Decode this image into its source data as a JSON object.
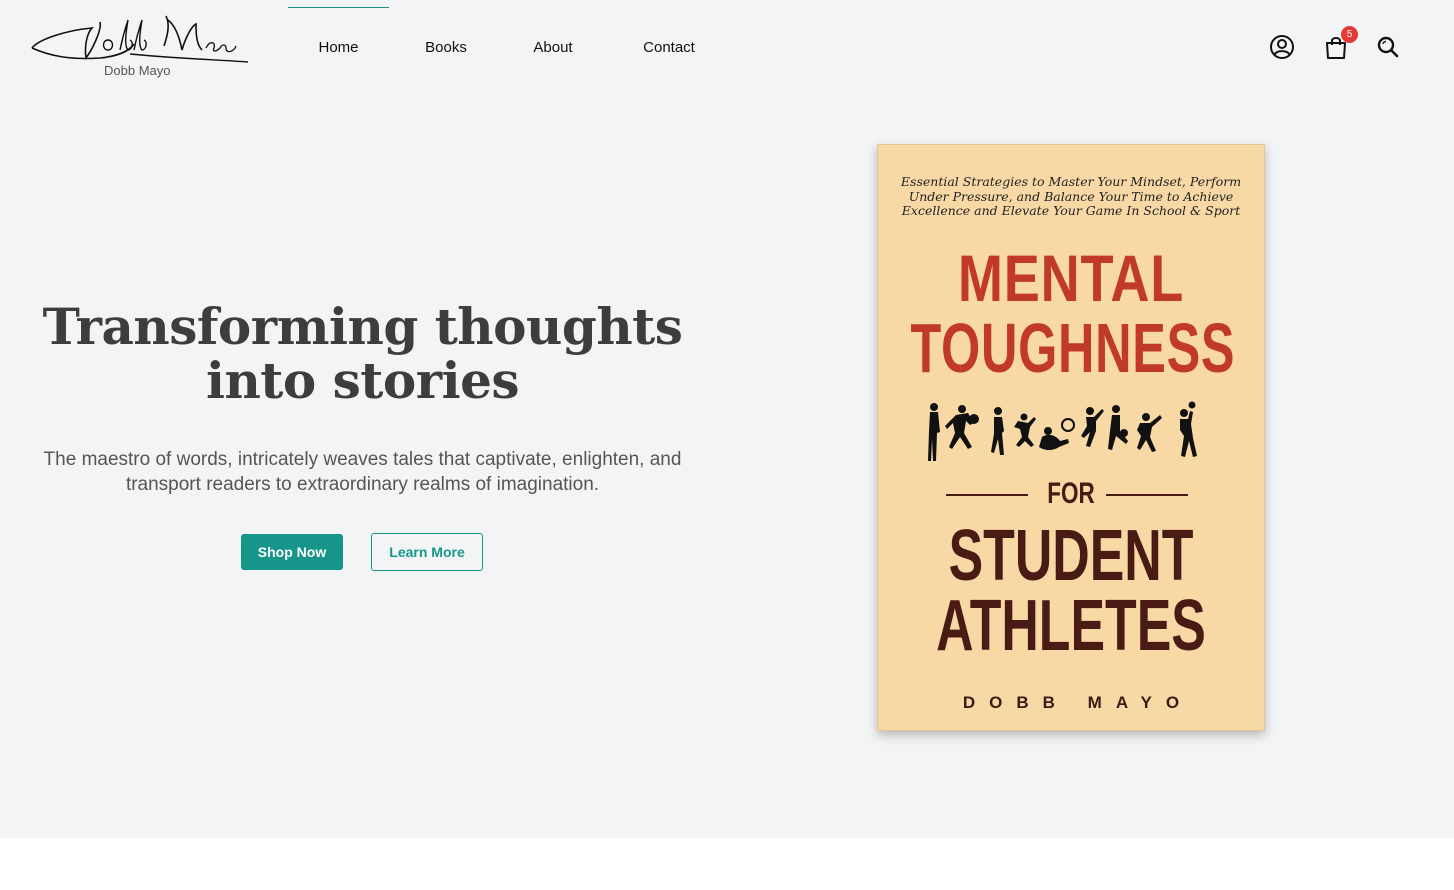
{
  "brand": {
    "signature": "Dobb Mayo",
    "caption": "Dobb Mayo"
  },
  "nav": {
    "items": [
      {
        "label": "Home",
        "active": true
      },
      {
        "label": "Books",
        "active": false
      },
      {
        "label": "About",
        "active": false
      },
      {
        "label": "Contact",
        "active": false
      }
    ]
  },
  "header_icons": {
    "account": "user-circle-icon",
    "cart": "shopping-bag-icon",
    "cart_count": "5",
    "search": "search-icon"
  },
  "hero": {
    "title_line1": "Transforming thoughts",
    "title_line2": "into stories",
    "subtitle": "The maestro of words, intricately weaves tales that captivate, enlighten, and transport readers to extraordinary realms of imagination.",
    "primary_button": "Shop Now",
    "secondary_button": "Learn More"
  },
  "book": {
    "tagline": "Essential Strategies to Master Your Mindset, Perform Under Pressure, and Balance Your Time to Achieve Excellence and Elevate Your Game In School & Sport",
    "title_line1": "MENTAL",
    "title_line2": "TOUGHNESS",
    "connector": "FOR",
    "title_line3": "STUDENT",
    "title_line4": "ATHLETES",
    "author": "DOBB MAYO"
  },
  "colors": {
    "accent": "#17958a",
    "hero_bg": "#f3f4f6",
    "badge": "#e53935",
    "cover_bg": "#f8d9a6",
    "cover_red": "#c0392b",
    "cover_dark": "#4a1a14"
  }
}
